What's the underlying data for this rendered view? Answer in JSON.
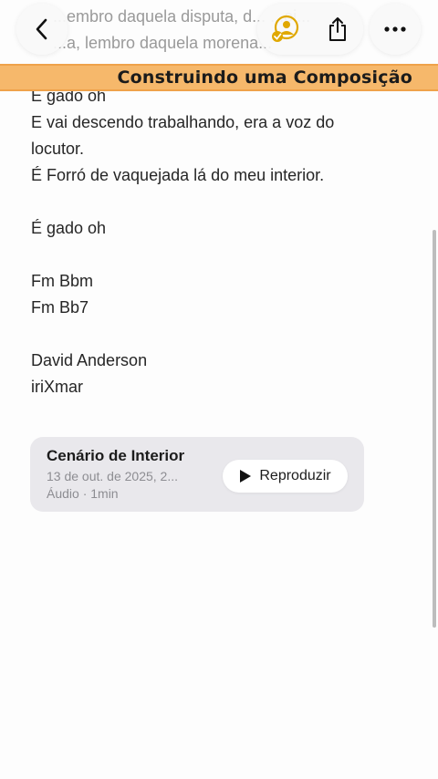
{
  "note": {
    "faded_lines": [
      "...embro daquela disputa, d... ...oi...",
      "...a, lembro daquela morena..."
    ],
    "lines": [
      "É gado oh",
      "E vai descendo trabalhando, era a voz do",
      "locutor.",
      "É Forró de vaquejada lá do meu interior.",
      "",
      "É gado oh",
      "",
      "Fm Bbm",
      "Fm Bb7",
      "",
      "David Anderson",
      "iriXmar"
    ]
  },
  "banner": {
    "text": "Construindo uma Composição",
    "color": "#f6b86b"
  },
  "audio": {
    "title": "Cenário de Interior",
    "date": "13 de out. de 2025, 2...",
    "meta": "Áudio · 1min",
    "play_label": "Reproduzir"
  },
  "toolbar": {
    "back_icon": "chevron-left-icon",
    "collab_icon": "person-checkmark-icon",
    "share_icon": "share-icon",
    "more_icon": "ellipsis-icon",
    "accent": "#e0a800"
  }
}
